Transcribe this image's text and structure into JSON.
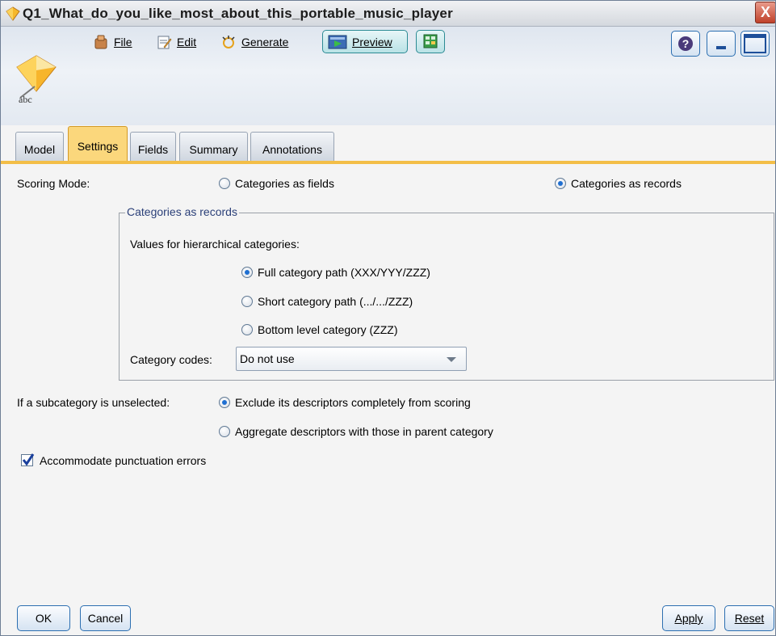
{
  "window": {
    "title": "Q1_What_do_you_like_most_about_this_portable_music_player",
    "close_label": "X"
  },
  "toolbar": {
    "file_label": "File",
    "edit_label": "Edit",
    "generate_label": "Generate",
    "preview_label": "Preview"
  },
  "logo": {
    "text": "abc"
  },
  "tabs": [
    {
      "label": "Model",
      "active": false
    },
    {
      "label": "Settings",
      "active": true
    },
    {
      "label": "Fields",
      "active": false
    },
    {
      "label": "Summary",
      "active": false
    },
    {
      "label": "Annotations",
      "active": false
    }
  ],
  "settings": {
    "scoring_mode_label": "Scoring Mode:",
    "scoring_mode_options": [
      {
        "label": "Categories as fields",
        "selected": false
      },
      {
        "label": "Categories as records",
        "selected": true
      }
    ],
    "group_title": "Categories as records",
    "hierarchy_label": "Values for hierarchical categories:",
    "hierarchy_options": [
      {
        "label": "Full category path (XXX/YYY/ZZZ)",
        "selected": true
      },
      {
        "label": "Short category path (.../.../ZZZ)",
        "selected": false
      },
      {
        "label": "Bottom level category (ZZZ)",
        "selected": false
      }
    ],
    "category_codes_label": "Category codes:",
    "category_codes_value": "Do not use",
    "subcategory_label": "If a subcategory is unselected:",
    "subcategory_options": [
      {
        "label": "Exclude its descriptors completely from scoring",
        "selected": true
      },
      {
        "label": "Aggregate descriptors with those in parent category",
        "selected": false
      }
    ],
    "punctuation_label": "Accommodate punctuation errors",
    "punctuation_checked": true
  },
  "buttons": {
    "ok": "OK",
    "cancel": "Cancel",
    "apply": "Apply",
    "reset": "Reset"
  },
  "colors": {
    "active_tab": "#fbd77c",
    "tab_underline": "#f3be47",
    "radio_selected": "#1f6fd1",
    "check_mark": "#1a3f9c"
  }
}
